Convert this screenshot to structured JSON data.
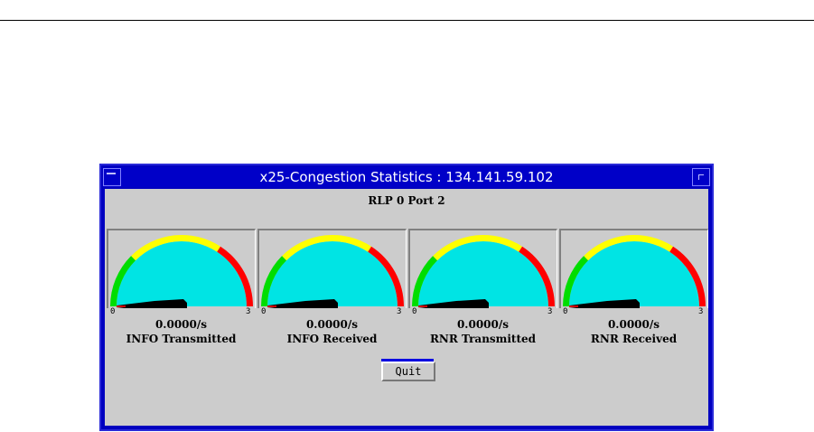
{
  "window": {
    "title": "x25-Congestion Statistics : 134.141.59.102",
    "subtitle": "RLP 0 Port 2"
  },
  "colors": {
    "face": "#00e4e4",
    "low": "#00dd00",
    "mid": "#ffff00",
    "high": "#ff0000",
    "needle": "#000000"
  },
  "gauges": [
    {
      "label": "INFO Transmitted",
      "value_text": "0.0000/s",
      "value": 0,
      "min": "0",
      "max": "3"
    },
    {
      "label": "INFO Received",
      "value_text": "0.0000/s",
      "value": 0,
      "min": "0",
      "max": "3"
    },
    {
      "label": "RNR Transmitted",
      "value_text": "0.0000/s",
      "value": 0,
      "min": "0",
      "max": "3"
    },
    {
      "label": "RNR Received",
      "value_text": "0.0000/s",
      "value": 0,
      "min": "0",
      "max": "3"
    }
  ],
  "quit_label": "Quit"
}
